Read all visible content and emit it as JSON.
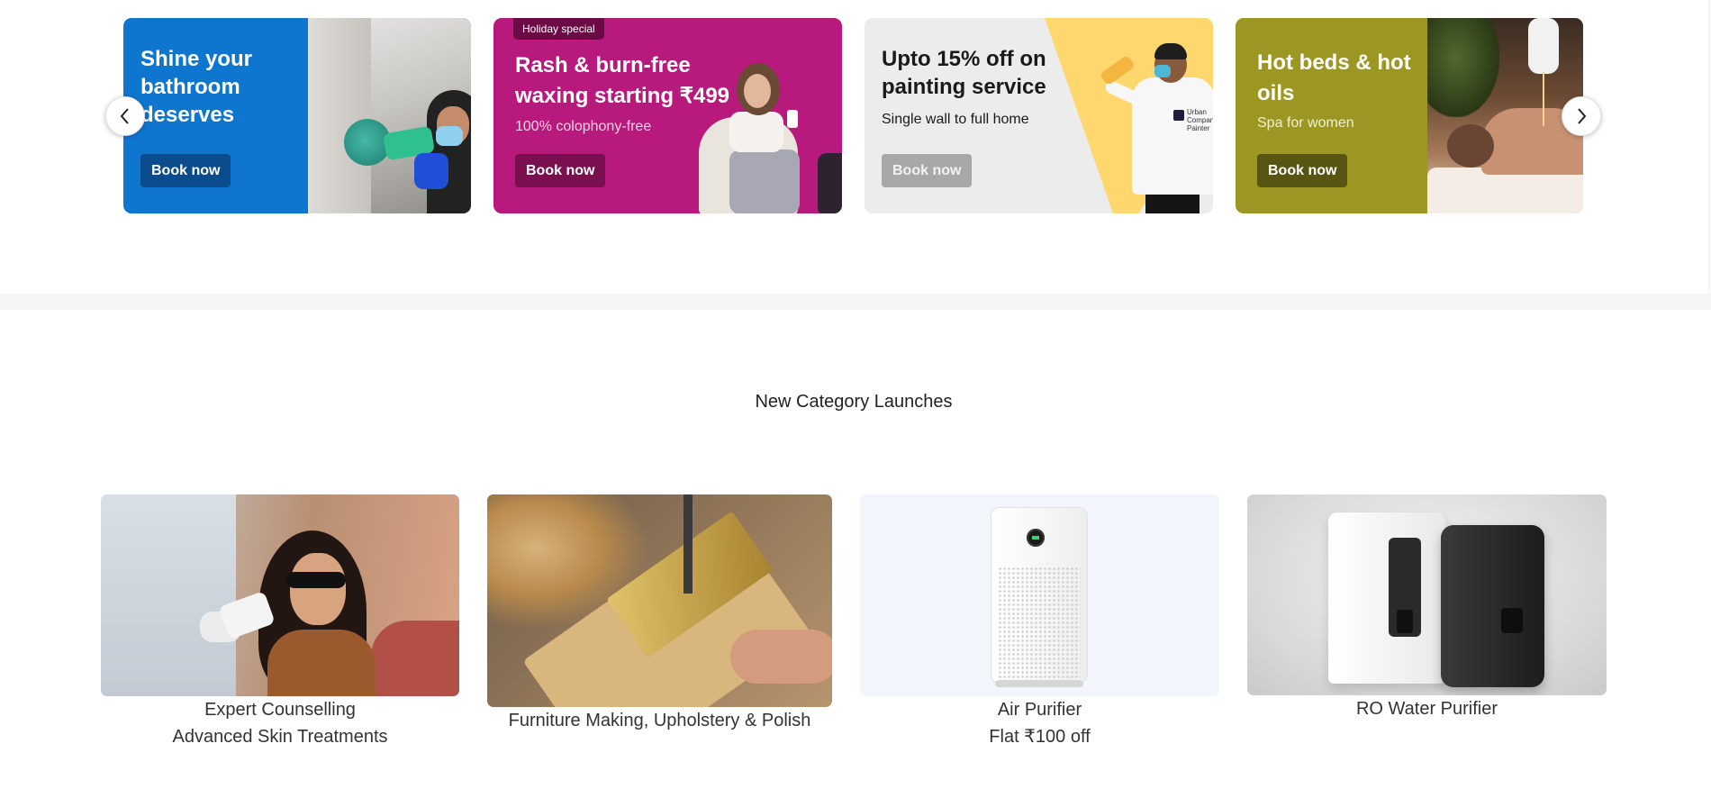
{
  "banners": [
    {
      "title": "Shine your bathroom deserves",
      "button": "Book now",
      "color": "#0f76d0"
    },
    {
      "tag": "Holiday special",
      "title": "Rash & burn-free waxing starting ₹499",
      "subtitle": "100% colophony-free",
      "button": "Book now",
      "color": "#b8197c"
    },
    {
      "title": "Upto 15% off on painting service",
      "subtitle": "Single wall to full home",
      "button": "Book now",
      "color": "#ececec",
      "logo_text": "Urban Company Painter"
    },
    {
      "title": "Hot beds & hot oils",
      "subtitle": "Spa for women",
      "button": "Book now",
      "color": "#9b9722"
    }
  ],
  "carousel": {
    "prev_icon": "chevron-left-icon",
    "next_icon": "chevron-right-icon"
  },
  "new_launches": {
    "title": "New Category Launches",
    "items": [
      {
        "line1": "Expert Counselling",
        "line2": "Advanced Skin Treatments"
      },
      {
        "line1": "Furniture Making, Upholstery & Polish",
        "line2": ""
      },
      {
        "line1": "Air Purifier",
        "line2": "Flat ₹100 off"
      },
      {
        "line1": "RO Water Purifier",
        "line2": ""
      }
    ]
  }
}
